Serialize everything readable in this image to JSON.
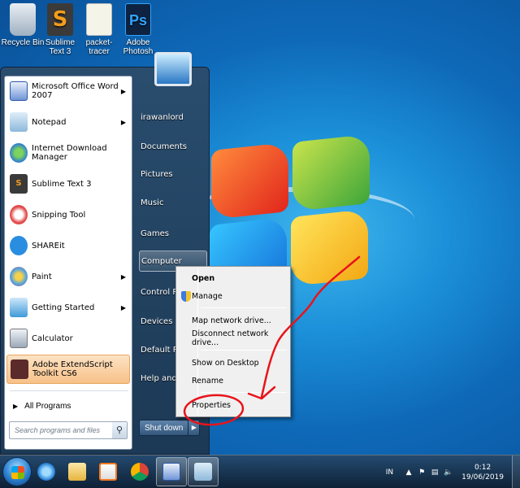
{
  "desktop": {
    "icons": [
      {
        "label": "Recycle Bin",
        "icon": "recycle-bin-icon"
      },
      {
        "label": "Sublime Text 3",
        "icon": "sublime-text-icon"
      },
      {
        "label": "packet-tracer",
        "icon": "packet-tracer-icon"
      },
      {
        "label": "Adobe Photosh",
        "icon": "photoshop-icon"
      }
    ],
    "photoshop_glyph": "Ps",
    "sublime_glyph": "S"
  },
  "start_menu": {
    "pinned": [
      {
        "label": "Microsoft Office Word 2007",
        "icon": "word-icon",
        "has_submenu": true
      },
      {
        "label": "Notepad",
        "icon": "notepad-icon",
        "has_submenu": true
      },
      {
        "label": "Internet Download Manager",
        "icon": "idm-icon",
        "has_submenu": false
      },
      {
        "label": "Sublime Text 3",
        "icon": "sublime-text-icon",
        "has_submenu": false
      },
      {
        "label": "Snipping Tool",
        "icon": "snipping-tool-icon",
        "has_submenu": false
      },
      {
        "label": "SHAREit",
        "icon": "shareit-icon",
        "has_submenu": false
      },
      {
        "label": "Paint",
        "icon": "paint-icon",
        "has_submenu": true
      },
      {
        "label": "Getting Started",
        "icon": "getting-started-icon",
        "has_submenu": true
      },
      {
        "label": "Calculator",
        "icon": "calculator-icon",
        "has_submenu": false
      },
      {
        "label": "Adobe ExtendScript Toolkit CS6",
        "icon": "adobe-extendscript-icon",
        "has_submenu": false,
        "selected": true
      }
    ],
    "all_programs": "All Programs",
    "search_placeholder": "Search programs and files",
    "right_items": [
      {
        "label": "irawanlord"
      },
      {
        "label": "Documents"
      },
      {
        "label": "Pictures"
      },
      {
        "label": "Music"
      },
      {
        "label": "Games"
      },
      {
        "label": "Computer",
        "hover": true
      },
      {
        "label": "Control Panel"
      },
      {
        "label": "Devices and Printers"
      },
      {
        "label": "Default Programs"
      },
      {
        "label": "Help and Support"
      }
    ],
    "shutdown_label": "Shut down"
  },
  "context_menu": {
    "items": [
      {
        "label": "Open",
        "bold": true
      },
      {
        "label": "Manage",
        "shield": true
      },
      {
        "separator": true
      },
      {
        "label": "Map network drive..."
      },
      {
        "label": "Disconnect network drive..."
      },
      {
        "separator": true
      },
      {
        "label": "Show on Desktop"
      },
      {
        "label": "Rename"
      },
      {
        "separator": true
      },
      {
        "label": "Properties",
        "circled": true
      }
    ]
  },
  "annotation": {
    "color": "#e8141a"
  },
  "taskbar": {
    "buttons": [
      {
        "name": "internet-explorer",
        "icon": "internet-explorer-icon"
      },
      {
        "name": "windows-explorer",
        "icon": "folder-icon"
      },
      {
        "name": "media-player",
        "icon": "media-player-icon"
      },
      {
        "name": "chrome",
        "icon": "chrome-icon"
      },
      {
        "name": "word",
        "icon": "word-icon",
        "active": true
      },
      {
        "name": "sticky-notes",
        "icon": "sticky-notes-icon",
        "active": true
      }
    ],
    "tray": {
      "language": "IN",
      "time": "0:12",
      "date": "19/06/2019"
    }
  }
}
